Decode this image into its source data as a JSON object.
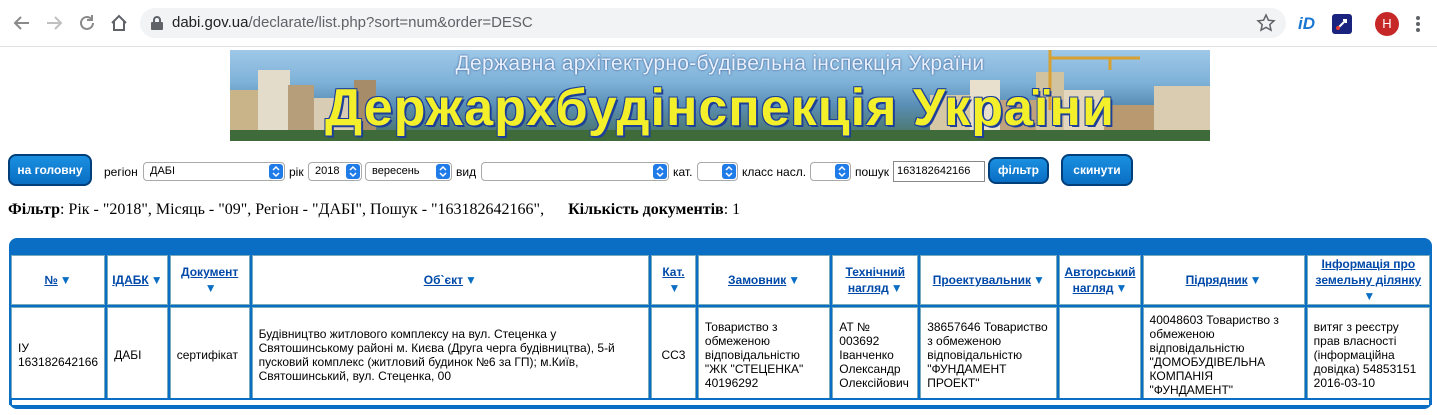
{
  "browser": {
    "url_host": "dabi.gov.ua",
    "url_path": "/declarate/list.php?sort=num&order=DESC",
    "ext_label": "iD",
    "avatar_letter": "H"
  },
  "banner": {
    "subtitle": "Державна архітектурно-будівельна інспекція України",
    "title": "Держархбудінспекція України"
  },
  "form": {
    "home_button": "на головну",
    "region_label": "регіон",
    "region_value": "ДАБІ",
    "year_label": "рік",
    "year_value": "2018",
    "month_value": "вересень",
    "kind_label": "вид",
    "kind_value": "",
    "cat_label": "кат.",
    "cat_value": "",
    "class_label": "класс насл.",
    "class_value": "",
    "search_label": "пошук",
    "search_value": "163182642166",
    "filter_button": "фільтр",
    "reset_button": "скинути"
  },
  "summary": {
    "filter_label": "Фільтр",
    "filter_text": ": Рік - \"2018\", Місяць - \"09\", Регіон - \"ДАБІ\", Пошук - \"163182642166\",",
    "count_label": "Кількість документів",
    "count_value": ": 1"
  },
  "table": {
    "headers": [
      "№",
      "ІДАБК",
      "Документ",
      "Об`єкт",
      "Кат.",
      "Замовник",
      "Технічний нагляд",
      "Проектувальник",
      "Авторський нагляд",
      "Підрядник",
      "Інформація про земельну ділянку"
    ],
    "sort_arrow": "▼",
    "rows": [
      [
        "ІУ 163182642166",
        "ДАБІ",
        "сертифікат",
        "Будівництво житлового комплексу на вул. Стеценка у Святошинському районі м. Києва (Друга черга будівництва), 5-й пусковий комплекс (житловий будинок №6 за ГП); м.Київ, Святошинський, вул. Стеценка, 00",
        "СС3",
        "Товариство з обмеженою відповідальністю \"ЖК \"СТЕЦЕНКА\" 40196292",
        "АТ № 003692 Іванченко Олександр Олексійович",
        "38657646 Товариство з обмеженою відповідальністю \"ФУНДАМЕНТ ПРОЕКТ\"",
        "",
        "40048603 Товариство з обмеженою відповідальністю \"ДОМОБУДІВЕЛЬНА КОМПАНІЯ \"ФУНДАМЕНТ\"",
        "витяг з реєстру прав власності (інформаційна довідка) 54853151 2016-03-10"
      ]
    ]
  }
}
